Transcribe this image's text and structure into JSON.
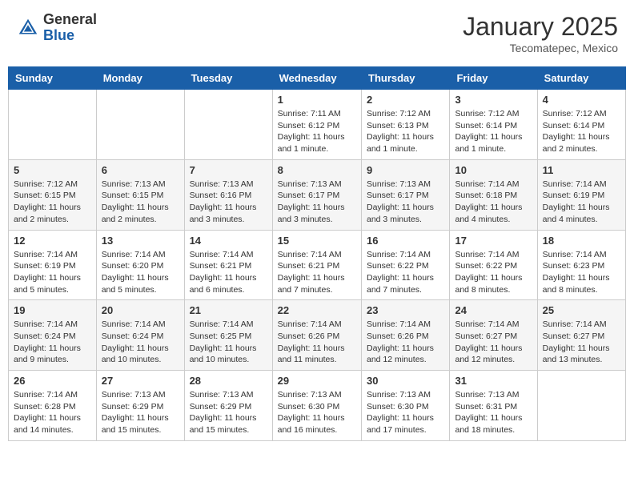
{
  "header": {
    "logo_general": "General",
    "logo_blue": "Blue",
    "month_title": "January 2025",
    "location": "Tecomatepec, Mexico"
  },
  "days_of_week": [
    "Sunday",
    "Monday",
    "Tuesday",
    "Wednesday",
    "Thursday",
    "Friday",
    "Saturday"
  ],
  "weeks": [
    [
      {
        "day": "",
        "info": ""
      },
      {
        "day": "",
        "info": ""
      },
      {
        "day": "",
        "info": ""
      },
      {
        "day": "1",
        "info": "Sunrise: 7:11 AM\nSunset: 6:12 PM\nDaylight: 11 hours and 1 minute."
      },
      {
        "day": "2",
        "info": "Sunrise: 7:12 AM\nSunset: 6:13 PM\nDaylight: 11 hours and 1 minute."
      },
      {
        "day": "3",
        "info": "Sunrise: 7:12 AM\nSunset: 6:14 PM\nDaylight: 11 hours and 1 minute."
      },
      {
        "day": "4",
        "info": "Sunrise: 7:12 AM\nSunset: 6:14 PM\nDaylight: 11 hours and 2 minutes."
      }
    ],
    [
      {
        "day": "5",
        "info": "Sunrise: 7:12 AM\nSunset: 6:15 PM\nDaylight: 11 hours and 2 minutes."
      },
      {
        "day": "6",
        "info": "Sunrise: 7:13 AM\nSunset: 6:15 PM\nDaylight: 11 hours and 2 minutes."
      },
      {
        "day": "7",
        "info": "Sunrise: 7:13 AM\nSunset: 6:16 PM\nDaylight: 11 hours and 3 minutes."
      },
      {
        "day": "8",
        "info": "Sunrise: 7:13 AM\nSunset: 6:17 PM\nDaylight: 11 hours and 3 minutes."
      },
      {
        "day": "9",
        "info": "Sunrise: 7:13 AM\nSunset: 6:17 PM\nDaylight: 11 hours and 3 minutes."
      },
      {
        "day": "10",
        "info": "Sunrise: 7:14 AM\nSunset: 6:18 PM\nDaylight: 11 hours and 4 minutes."
      },
      {
        "day": "11",
        "info": "Sunrise: 7:14 AM\nSunset: 6:19 PM\nDaylight: 11 hours and 4 minutes."
      }
    ],
    [
      {
        "day": "12",
        "info": "Sunrise: 7:14 AM\nSunset: 6:19 PM\nDaylight: 11 hours and 5 minutes."
      },
      {
        "day": "13",
        "info": "Sunrise: 7:14 AM\nSunset: 6:20 PM\nDaylight: 11 hours and 5 minutes."
      },
      {
        "day": "14",
        "info": "Sunrise: 7:14 AM\nSunset: 6:21 PM\nDaylight: 11 hours and 6 minutes."
      },
      {
        "day": "15",
        "info": "Sunrise: 7:14 AM\nSunset: 6:21 PM\nDaylight: 11 hours and 7 minutes."
      },
      {
        "day": "16",
        "info": "Sunrise: 7:14 AM\nSunset: 6:22 PM\nDaylight: 11 hours and 7 minutes."
      },
      {
        "day": "17",
        "info": "Sunrise: 7:14 AM\nSunset: 6:22 PM\nDaylight: 11 hours and 8 minutes."
      },
      {
        "day": "18",
        "info": "Sunrise: 7:14 AM\nSunset: 6:23 PM\nDaylight: 11 hours and 8 minutes."
      }
    ],
    [
      {
        "day": "19",
        "info": "Sunrise: 7:14 AM\nSunset: 6:24 PM\nDaylight: 11 hours and 9 minutes."
      },
      {
        "day": "20",
        "info": "Sunrise: 7:14 AM\nSunset: 6:24 PM\nDaylight: 11 hours and 10 minutes."
      },
      {
        "day": "21",
        "info": "Sunrise: 7:14 AM\nSunset: 6:25 PM\nDaylight: 11 hours and 10 minutes."
      },
      {
        "day": "22",
        "info": "Sunrise: 7:14 AM\nSunset: 6:26 PM\nDaylight: 11 hours and 11 minutes."
      },
      {
        "day": "23",
        "info": "Sunrise: 7:14 AM\nSunset: 6:26 PM\nDaylight: 11 hours and 12 minutes."
      },
      {
        "day": "24",
        "info": "Sunrise: 7:14 AM\nSunset: 6:27 PM\nDaylight: 11 hours and 12 minutes."
      },
      {
        "day": "25",
        "info": "Sunrise: 7:14 AM\nSunset: 6:27 PM\nDaylight: 11 hours and 13 minutes."
      }
    ],
    [
      {
        "day": "26",
        "info": "Sunrise: 7:14 AM\nSunset: 6:28 PM\nDaylight: 11 hours and 14 minutes."
      },
      {
        "day": "27",
        "info": "Sunrise: 7:13 AM\nSunset: 6:29 PM\nDaylight: 11 hours and 15 minutes."
      },
      {
        "day": "28",
        "info": "Sunrise: 7:13 AM\nSunset: 6:29 PM\nDaylight: 11 hours and 15 minutes."
      },
      {
        "day": "29",
        "info": "Sunrise: 7:13 AM\nSunset: 6:30 PM\nDaylight: 11 hours and 16 minutes."
      },
      {
        "day": "30",
        "info": "Sunrise: 7:13 AM\nSunset: 6:30 PM\nDaylight: 11 hours and 17 minutes."
      },
      {
        "day": "31",
        "info": "Sunrise: 7:13 AM\nSunset: 6:31 PM\nDaylight: 11 hours and 18 minutes."
      },
      {
        "day": "",
        "info": ""
      }
    ]
  ]
}
